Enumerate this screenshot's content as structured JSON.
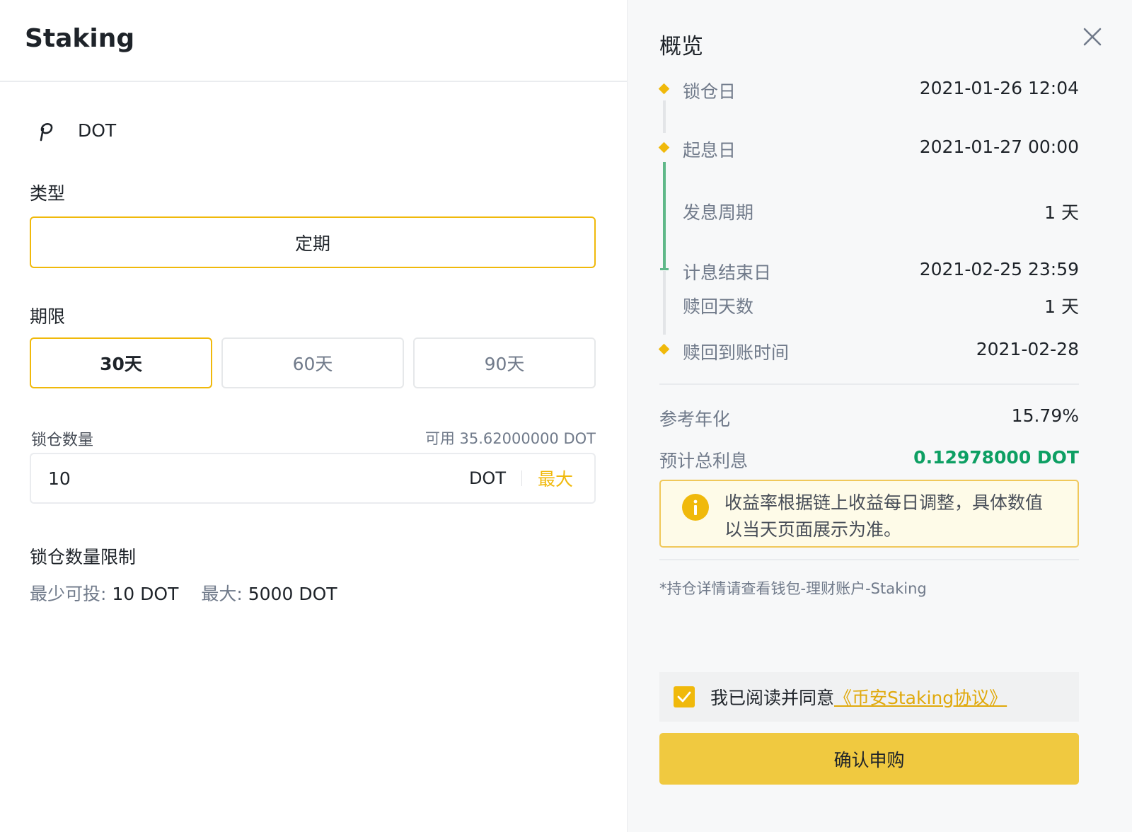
{
  "left": {
    "title": "Staking",
    "coin": {
      "icon": "polkadot-icon",
      "name": "DOT"
    },
    "type_label": "类型",
    "type_value": "定期",
    "term_label": "期限",
    "terms": [
      {
        "label": "30天",
        "selected": true
      },
      {
        "label": "60天",
        "selected": false
      },
      {
        "label": "90天",
        "selected": false
      }
    ],
    "amount": {
      "label": "锁仓数量",
      "available": "可用 35.62000000 DOT",
      "value": "10",
      "unit": "DOT",
      "max_label": "最大"
    },
    "limits": {
      "label": "锁仓数量限制",
      "min_label": "最少可投:",
      "min_value": "10 DOT",
      "max_label": "最大:",
      "max_value": "5000 DOT"
    }
  },
  "right": {
    "title": "概览",
    "close_icon": "close-icon",
    "timeline": [
      {
        "key": "锁仓日",
        "value": "2021-01-26 12:04"
      },
      {
        "key": "起息日",
        "value": "2021-01-27 00:00"
      },
      {
        "key": "发息周期",
        "value": "1 天"
      },
      {
        "key": "计息结束日",
        "value": "2021-02-25 23:59"
      },
      {
        "key": "赎回天数",
        "value": "1 天"
      },
      {
        "key": "赎回到账时间",
        "value": "2021-02-28"
      }
    ],
    "summary": {
      "apy_label": "参考年化",
      "apy_value": "15.79%",
      "interest_label": "预计总利息",
      "interest_value": "0.12978000 DOT"
    },
    "notice": {
      "icon": "info-icon",
      "line1": "收益率根据链上收益每日调整，具体数值",
      "line2": "以当天页面展示为准。"
    },
    "holding_note": "*持仓详情请查看钱包-理财账户-Staking",
    "agreement": {
      "checked": true,
      "text": "我已阅读并同意",
      "link": "《币安Staking协议》"
    },
    "confirm_label": "确认申购"
  },
  "colors": {
    "accent": "#f0b90b",
    "button": "#f0c940",
    "positive": "#0d9f63",
    "timeline_green": "#5fb889"
  }
}
